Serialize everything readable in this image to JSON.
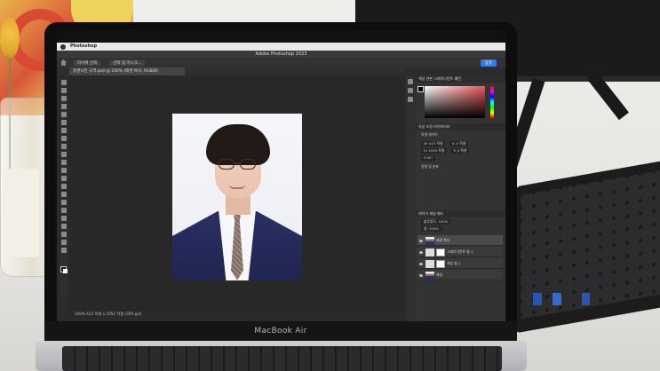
{
  "scene": {
    "laptop_label": "MacBook Air",
    "monitor_brand": ""
  },
  "app": {
    "menu_app": "Photoshop",
    "window_title": "Adobe Photoshop 2023",
    "share_label": "공유",
    "doc_tab": "증명사진 규격.psd @ 100% (배경 복사, RGB/8)",
    "zoom_status": "100%  413 픽셀 x 1051 픽셀 (300 ppi)",
    "select_subject": "피사체 선택",
    "select_mask": "선택 및 마스크..."
  },
  "panels": {
    "color_tabs": "색상  견본  그레이디언트  패턴",
    "properties_tabs": "속성  조정  라이브러리",
    "properties_type": "픽셀 레이어",
    "width_label": "W: 413 픽셀",
    "height_label": "H: 1049 픽셀",
    "x_label": "X: 0 픽셀",
    "y_label": "Y: 0 픽셀",
    "angle_label": "0.00°",
    "align_label": "정렬 및 분포",
    "layers_tabs": "레이어  채널  패스",
    "opacity_label": "불투명도: 100%",
    "fill_label": "칠: 100%",
    "layers": [
      {
        "name": "배경 복사",
        "selected": true
      },
      {
        "name": "그레이디언트 칠 1",
        "selected": false
      },
      {
        "name": "색상 칠 1",
        "selected": false
      },
      {
        "name": "배경",
        "selected": false
      }
    ]
  }
}
